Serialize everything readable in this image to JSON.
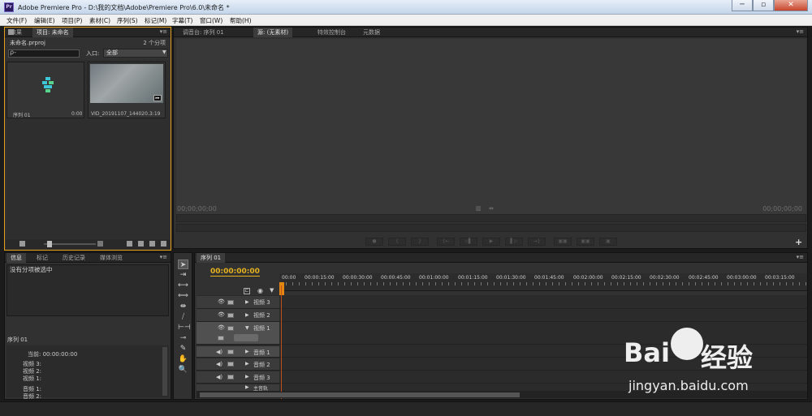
{
  "window": {
    "title": "Adobe Premiere Pro - D:\\我的文档\\Adobe\\Premiere Pro\\6.0\\未命名 *",
    "app_icon_text": "Pr",
    "min_label": "─",
    "max_label": "▫",
    "close_label": "✕"
  },
  "menubar": {
    "items": [
      "文件(F)",
      "编辑(E)",
      "项目(P)",
      "素材(C)",
      "序列(S)",
      "标记(M)",
      "字幕(T)",
      "窗口(W)",
      "帮助(H)"
    ]
  },
  "project_panel": {
    "tabs": [
      "效果",
      "项目: 未命名"
    ],
    "menu_icon": "▾≡",
    "file_name": "未命名.prproj",
    "item_count": "2 个分项",
    "search_value": "",
    "search_icon": "ρ-",
    "in_label": "入口:",
    "in_value": "全部",
    "clips": [
      {
        "name": "序列 01",
        "duration": "0:00"
      },
      {
        "name": "VID_20191107_144020...",
        "duration": "3:19"
      }
    ]
  },
  "source_panel": {
    "tabs": [
      "调音台: 序列 01",
      "源: (无素材)",
      "特效控制台",
      "元数据"
    ],
    "menu_icon": "▾≡",
    "tc_left": "00;00;00;00",
    "tc_right": "00;00;00;00",
    "mid_icon_1": "▥",
    "mid_icon_2": "⇹",
    "transport": [
      "●",
      "{",
      "}",
      "{←",
      "◁▌",
      "▶",
      "▌▷",
      "→}",
      "▣▣",
      "▣▣",
      "▣"
    ],
    "plus_icon": "+"
  },
  "info_panel": {
    "tabs": [
      "信息",
      "标记",
      "历史记录",
      "媒体浏览"
    ],
    "menu_icon": "▾≡",
    "no_selection": "没有分项被选中",
    "sequence": "序列 01",
    "current": "当前: 00:00:00:00",
    "rows": [
      "视频 3:",
      "视频 2:",
      "视频 1:",
      "音频 1:",
      "音频 2:"
    ]
  },
  "tools": [
    "➤",
    "⇥",
    "⟷",
    "⟺",
    "⇼",
    "⧸",
    "⊢⊣",
    "⊸",
    "✎",
    "✋",
    "🔍"
  ],
  "timeline_panel": {
    "tab": "序列 01",
    "menu_icon": "▾≡",
    "timecode": "00:00:00:00",
    "ruler_labels": [
      "00:00",
      "00:00:15:00",
      "00:00:30:00",
      "00:00:45:00",
      "00:01:00:00",
      "00:01:15:00",
      "00:01:30:00",
      "00:01:45:00",
      "00:02:00:00",
      "00:02:15:00",
      "00:02:30:00",
      "00:02:45:00",
      "00:03:00:00",
      "00:03:15:00"
    ],
    "video_tracks": [
      "视频 3",
      "视频 2",
      "视频 1"
    ],
    "audio_tracks": [
      "音频 1",
      "音频 2",
      "音频 3"
    ],
    "master_track": "主音轨",
    "snap_icon": "⊏",
    "marker_icon": "◉",
    "flag_icon": "▼",
    "eye_icon": "👁",
    "speaker_icon": "◀)",
    "expand_icon": "▶",
    "collapse_icon": "▼"
  },
  "watermark": {
    "brand_left": "Bai",
    "brand_right": "经验",
    "url": "jingyan.baidu.com"
  }
}
